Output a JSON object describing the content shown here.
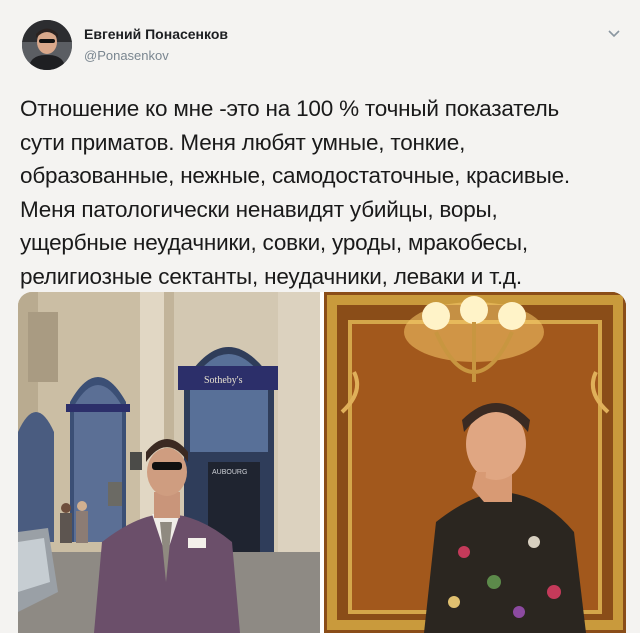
{
  "author": {
    "name": "Евгений Понасенков",
    "handle": "@Ponasenkov",
    "avatar": "avatar"
  },
  "menu_icon": "chevron-down-icon",
  "tweet": {
    "text": "Отношение ко мне -это на 100 % точный показатель\nсути приматов. Меня любят умные, тонкие,\nобразованные, нежные, самодостаточные, красивые.\nМеня патологически ненавидят убийцы, воры,\nущербные неудачники, совки, уроды, мракобесы,\nрелигиозные сектанты, неудачники, леваки и т.д."
  },
  "media": {
    "left_photo": {
      "shop_sign": "Sotheby's",
      "window_text": "AUBOURG"
    },
    "right_photo": {}
  },
  "colors": {
    "background": "#f4f3f1",
    "handle": "#7a8690",
    "facade": "#cdbfa6",
    "awning": "#2c2f6a",
    "gold": "#b8862a"
  }
}
